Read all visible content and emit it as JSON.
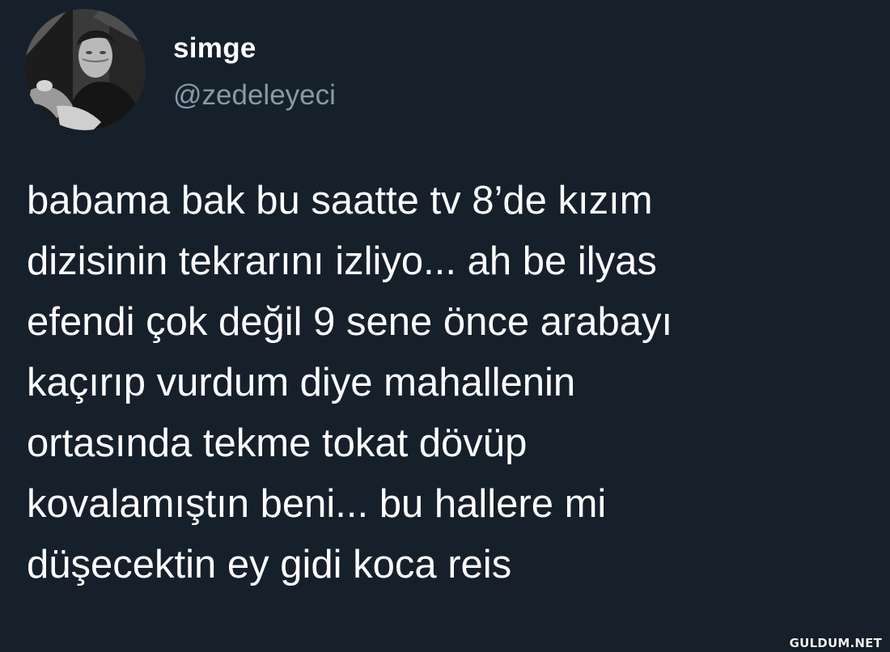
{
  "tweet": {
    "author": {
      "display_name": "simge",
      "handle": "@zedeleyeci"
    },
    "text": "babama bak bu saatte tv 8’de kızım\ndizisinin tekrarını izliyo... ah be ilyas\nefendi çok değil 9 sene önce arabayı\nkaçırıp vurdum diye mahallenin\nortasında tekme tokat dövüp\nkovalamıştın beni... bu hallere mi\ndüşecektin ey gidi koca reis"
  },
  "watermark": "GULDUM.NET",
  "colors": {
    "background": "#15202b",
    "text_primary": "#ffffff",
    "text_secondary": "#8899a6"
  }
}
